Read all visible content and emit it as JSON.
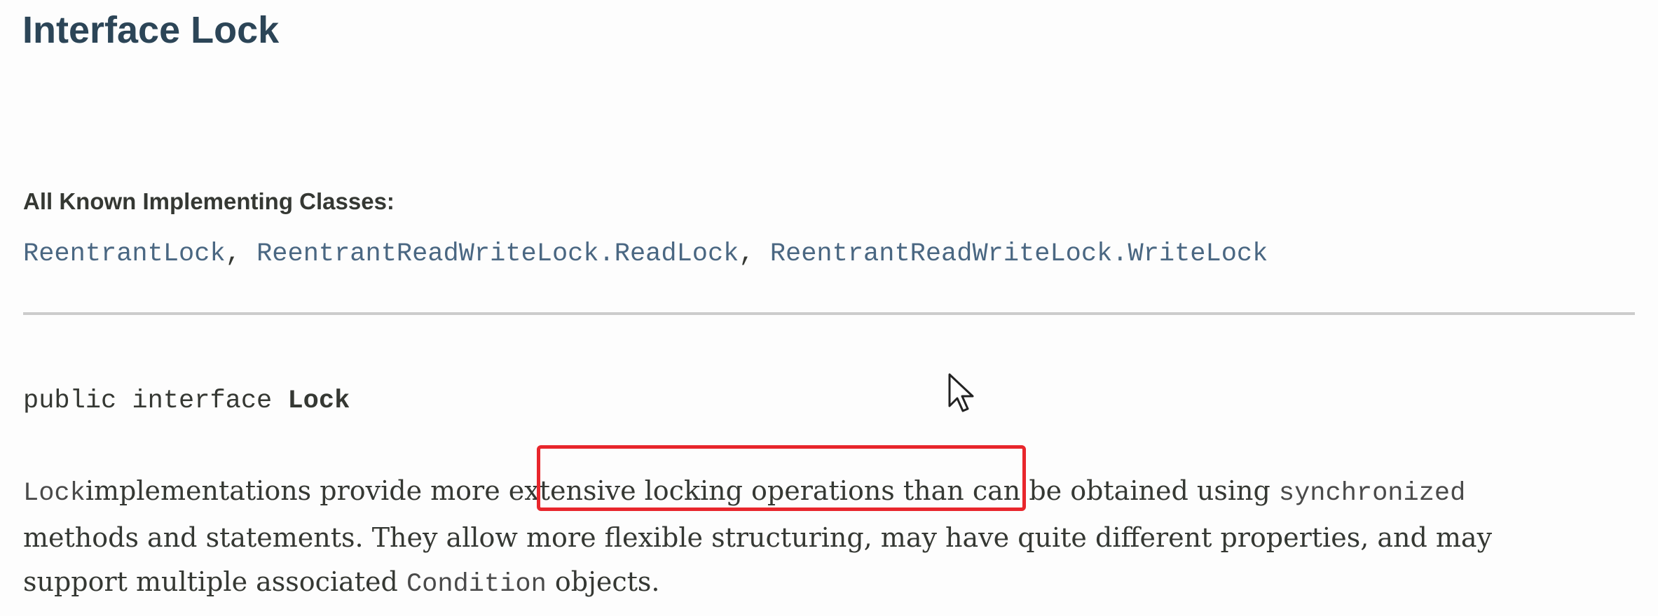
{
  "page": {
    "title": "Interface Lock"
  },
  "implementing_classes": {
    "label": "All Known Implementing Classes:",
    "classes": [
      "ReentrantLock",
      "ReentrantReadWriteLock.ReadLock",
      "ReentrantReadWriteLock.WriteLock"
    ],
    "separator": ", "
  },
  "signature": {
    "modifiers": "public interface ",
    "name": "Lock"
  },
  "description": {
    "line1_code1": "Lock",
    "line1_text1": "implementations provide more ",
    "line1_highlight": "extensive locking operations than ",
    "line1_text2": "can be obtained using ",
    "line1_code2": "synchronized",
    "line2": "methods and statements. They allow more flexible structuring, may have quite different properties, and may",
    "line3_text1": "support multiple associated ",
    "line3_code": "Condition",
    "line3_text2": " objects."
  },
  "annotation": {
    "highlight_color": "#e8262c"
  },
  "icons": {
    "cursor": "mouse-pointer-icon"
  }
}
